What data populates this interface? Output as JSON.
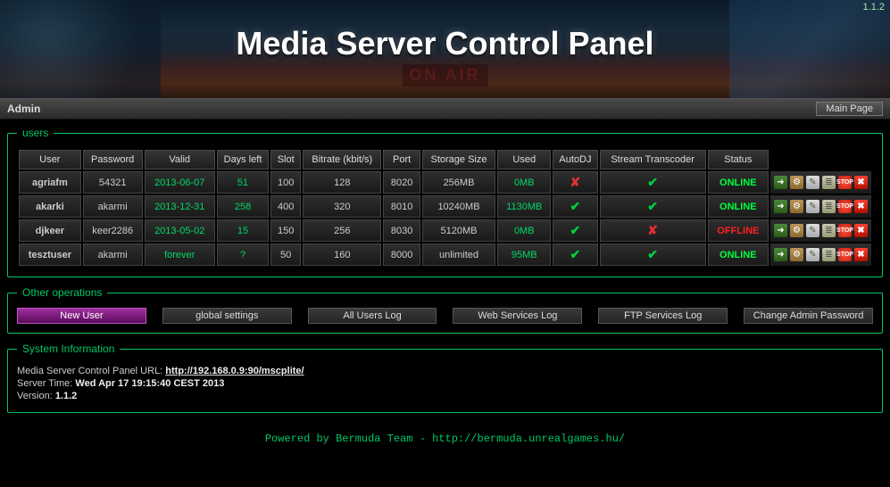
{
  "version_top": "1.1.2",
  "title": "Media Server Control Panel",
  "onair": "ON AIR",
  "toolbar": {
    "left": "Admin",
    "main_page": "Main Page"
  },
  "users_legend": "users",
  "columns": {
    "user": "User",
    "password": "Password",
    "valid": "Valid",
    "days_left": "Days left",
    "slot": "Slot",
    "bitrate": "Bitrate (kbit/s)",
    "port": "Port",
    "storage": "Storage Size",
    "used": "Used",
    "autodj": "AutoDJ",
    "transcoder": "Stream Transcoder",
    "status": "Status"
  },
  "rows": [
    {
      "user": "agriafm",
      "password": "54321",
      "valid": "2013-06-07",
      "days_left": "51",
      "slot": "100",
      "bitrate": "128",
      "port": "8020",
      "storage": "256MB",
      "used": "0MB",
      "autodj": false,
      "transcoder": true,
      "status": "ONLINE"
    },
    {
      "user": "akarki",
      "password": "akarmi",
      "valid": "2013-12-31",
      "days_left": "258",
      "slot": "400",
      "bitrate": "320",
      "port": "8010",
      "storage": "10240MB",
      "used": "1130MB",
      "autodj": true,
      "transcoder": true,
      "status": "ONLINE"
    },
    {
      "user": "djkeer",
      "password": "keer2286",
      "valid": "2013-05-02",
      "days_left": "15",
      "slot": "150",
      "bitrate": "256",
      "port": "8030",
      "storage": "5120MB",
      "used": "0MB",
      "autodj": true,
      "transcoder": false,
      "status": "OFFLINE"
    },
    {
      "user": "tesztuser",
      "password": "akarmi",
      "valid": "forever",
      "days_left": "?",
      "slot": "50",
      "bitrate": "160",
      "port": "8000",
      "storage": "unlimited",
      "used": "95MB",
      "autodj": true,
      "transcoder": true,
      "status": "ONLINE"
    }
  ],
  "ops_legend": "Other operations",
  "ops": {
    "new_user": "New User",
    "global_settings": "global settings",
    "all_users_log": "All Users Log",
    "web_services_log": "Web Services Log",
    "ftp_services_log": "FTP Services Log",
    "change_admin_pw": "Change Admin Password"
  },
  "sysinfo_legend": "System Information",
  "sysinfo": {
    "url_label": "Media Server Control Panel URL: ",
    "url": "http://192.168.0.9:90/mscplite/",
    "time_label": "Server Time: ",
    "time": "Wed Apr 17 19:15:40 CEST 2013",
    "version_label": "Version: ",
    "version": "1.1.2"
  },
  "footer": {
    "text": "Powered by Bermuda Team - ",
    "link": "http://bermuda.unrealgames.hu/"
  }
}
